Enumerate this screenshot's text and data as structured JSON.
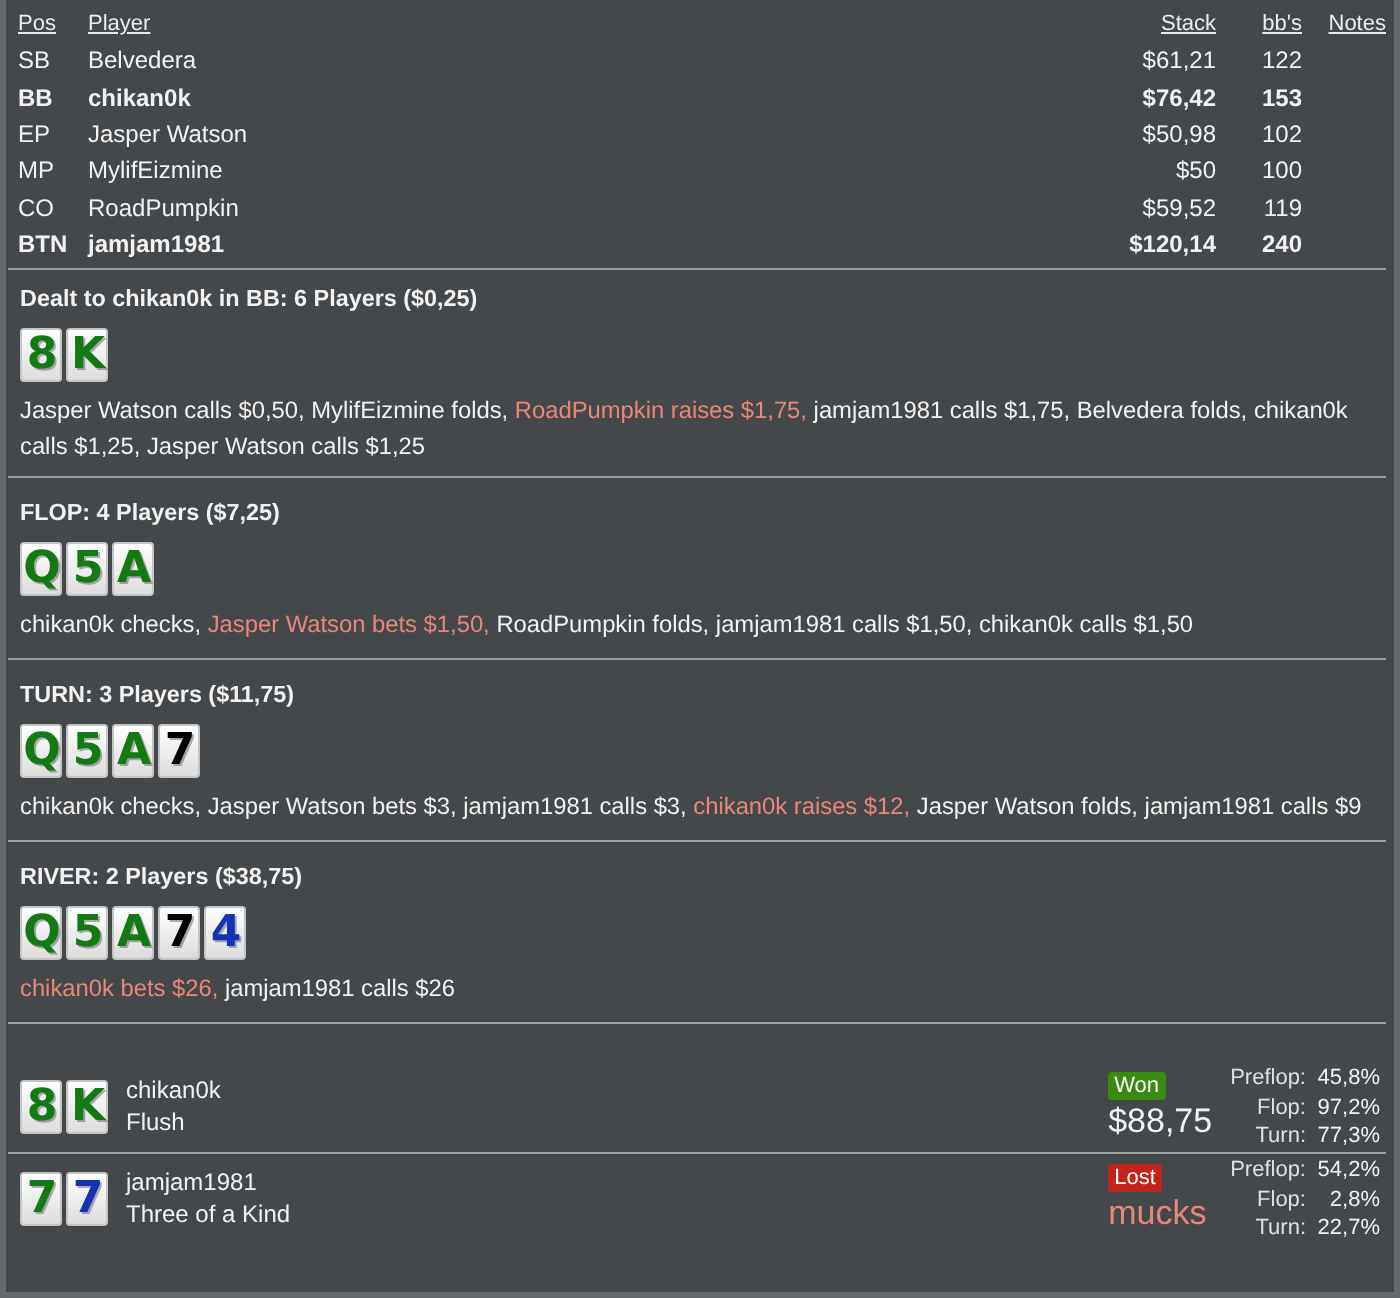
{
  "players_table": {
    "columns": [
      "Pos",
      "Player",
      "Stack",
      "bb's",
      "Notes"
    ],
    "rows": [
      {
        "position": "SB",
        "player": "Belvedera",
        "stack": "$61,21",
        "bbs": "122",
        "highlighted": false
      },
      {
        "position": "BB",
        "player": "chikan0k",
        "stack": "$76,42",
        "bbs": "153",
        "highlighted": true
      },
      {
        "position": "EP",
        "player": "Jasper Watson",
        "stack": "$50,98",
        "bbs": "102",
        "highlighted": false
      },
      {
        "position": "MP",
        "player": "MylifEizmine",
        "stack": "$50",
        "bbs": "100",
        "highlighted": false
      },
      {
        "position": "CO",
        "player": "RoadPumpkin",
        "stack": "$59,52",
        "bbs": "119",
        "highlighted": false
      },
      {
        "position": "BTN",
        "player": "jamjam1981",
        "stack": "$120,14",
        "bbs": "240",
        "highlighted": true
      }
    ]
  },
  "streets": [
    {
      "title": "Dealt to chikan0k in BB: 6 Players ($0,25)",
      "cards": [
        {
          "rank": "8",
          "color": "#137a13"
        },
        {
          "rank": "K",
          "color": "#137a13"
        }
      ],
      "actions": [
        {
          "text": "Jasper Watson calls $0,50,",
          "highlighted": false
        },
        {
          "text": "MylifEizmine folds,",
          "highlighted": false
        },
        {
          "text": "RoadPumpkin raises $1,75,",
          "highlighted": true
        },
        {
          "text": "jamjam1981 calls $1,75,",
          "highlighted": false
        },
        {
          "text": "Belvedera folds,",
          "highlighted": false
        },
        {
          "text": "chikan0k calls $1,25,",
          "highlighted": false
        },
        {
          "text": "Jasper Watson calls $1,25",
          "highlighted": false
        }
      ]
    },
    {
      "title": "FLOP: 4 Players ($7,25)",
      "cards": [
        {
          "rank": "Q",
          "color": "#137a13"
        },
        {
          "rank": "5",
          "color": "#137a13"
        },
        {
          "rank": "A",
          "color": "#137a13"
        }
      ],
      "actions": [
        {
          "text": "chikan0k checks,",
          "highlighted": false
        },
        {
          "text": "Jasper Watson bets $1,50,",
          "highlighted": true
        },
        {
          "text": "RoadPumpkin folds,",
          "highlighted": false
        },
        {
          "text": "jamjam1981 calls $1,50,",
          "highlighted": false
        },
        {
          "text": "chikan0k calls $1,50",
          "highlighted": false
        }
      ]
    },
    {
      "title": "TURN: 3 Players ($11,75)",
      "cards": [
        {
          "rank": "Q",
          "color": "#137a13"
        },
        {
          "rank": "5",
          "color": "#137a13"
        },
        {
          "rank": "A",
          "color": "#137a13"
        },
        {
          "rank": "7",
          "color": "#000000"
        }
      ],
      "actions": [
        {
          "text": "chikan0k checks,",
          "highlighted": false
        },
        {
          "text": "Jasper Watson bets $3,",
          "highlighted": false
        },
        {
          "text": "jamjam1981 calls $3,",
          "highlighted": false
        },
        {
          "text": "chikan0k raises $12,",
          "highlighted": true
        },
        {
          "text": "Jasper Watson folds,",
          "highlighted": false
        },
        {
          "text": "jamjam1981 calls $9",
          "highlighted": false
        }
      ]
    },
    {
      "title": "RIVER: 2 Players ($38,75)",
      "cards": [
        {
          "rank": "Q",
          "color": "#137a13"
        },
        {
          "rank": "5",
          "color": "#137a13"
        },
        {
          "rank": "A",
          "color": "#137a13"
        },
        {
          "rank": "7",
          "color": "#000000"
        },
        {
          "rank": "4",
          "color": "#1433b4"
        }
      ],
      "actions": [
        {
          "text": "chikan0k bets $26,",
          "highlighted": true
        },
        {
          "text": "jamjam1981 calls $26",
          "highlighted": false
        }
      ]
    }
  ],
  "showdown": [
    {
      "cards": [
        {
          "rank": "8",
          "color": "#137a13"
        },
        {
          "rank": "K",
          "color": "#137a13"
        }
      ],
      "player": "chikan0k",
      "hand": "Flush",
      "won": true,
      "badge": "Won",
      "result_text": "$88,75",
      "equity": [
        {
          "label": "Preflop:",
          "value": "45,8%"
        },
        {
          "label": "Flop:",
          "value": "97,2%"
        },
        {
          "label": "Turn:",
          "value": "77,3%"
        }
      ]
    },
    {
      "cards": [
        {
          "rank": "7",
          "color": "#137a13"
        },
        {
          "rank": "7",
          "color": "#1433b4"
        }
      ],
      "player": "jamjam1981",
      "hand": "Three of a Kind",
      "won": false,
      "badge": "Lost",
      "result_text": "mucks",
      "equity": [
        {
          "label": "Preflop:",
          "value": "54,2%"
        },
        {
          "label": "Flop:",
          "value": "2,8%"
        },
        {
          "label": "Turn:",
          "value": "22,7%"
        }
      ]
    }
  ]
}
